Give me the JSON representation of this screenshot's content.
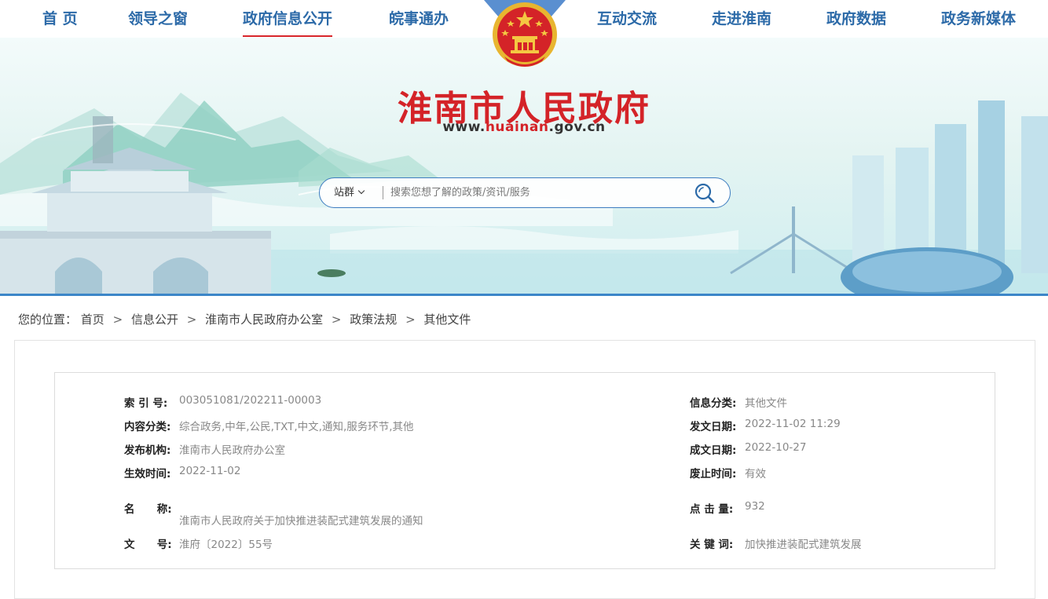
{
  "nav": {
    "items": [
      "首 页",
      "领导之窗",
      "政府信息公开",
      "皖事通办",
      "互动交流",
      "走进淮南",
      "政府数据",
      "政务新媒体"
    ],
    "active_index": 2
  },
  "header": {
    "site_title": "淮南市人民政府",
    "url_prefix": "www.",
    "url_accent": "huainan",
    "url_suffix": ".gov.cn"
  },
  "search": {
    "scope_label": "站群",
    "placeholder": "搜索您想了解的政策/资讯/服务",
    "icon": "search-icon"
  },
  "breadcrumb": {
    "prefix": "您的位置：",
    "items": [
      "首页",
      "信息公开",
      "淮南市人民政府办公室",
      "政策法规",
      "其他文件"
    ],
    "separator": ">"
  },
  "meta": {
    "index_no": {
      "label": "索 引 号:",
      "value": "003051081/202211-00003"
    },
    "info_category": {
      "label": "信息分类:",
      "value": "其他文件"
    },
    "content_category": {
      "label": "内容分类:",
      "value": "综合政务,中年,公民,TXT,中文,通知,服务环节,其他"
    },
    "issue_date": {
      "label": "发文日期:",
      "value": "2022-11-02 11:29"
    },
    "publisher": {
      "label": "发布机构:",
      "value": "淮南市人民政府办公室"
    },
    "written_date": {
      "label": "成文日期:",
      "value": "2022-10-27"
    },
    "effective_date": {
      "label": "生效时间:",
      "value": "2022-11-02"
    },
    "expiry": {
      "label": "废止时间:",
      "value": "有效"
    },
    "name": {
      "label": "名      称:",
      "value": "淮南市人民政府关于加快推进装配式建筑发展的通知"
    },
    "clicks": {
      "label": "点 击 量:",
      "value": "932"
    },
    "doc_no": {
      "label": "文      号:",
      "value": "淮府〔2022〕55号"
    },
    "keywords": {
      "label": "关 键 词:",
      "value": "加快推进装配式建筑发展"
    }
  },
  "colors": {
    "nav_text": "#2c6aa8",
    "accent_red": "#d42328",
    "border_blue": "#3d7cc0"
  }
}
